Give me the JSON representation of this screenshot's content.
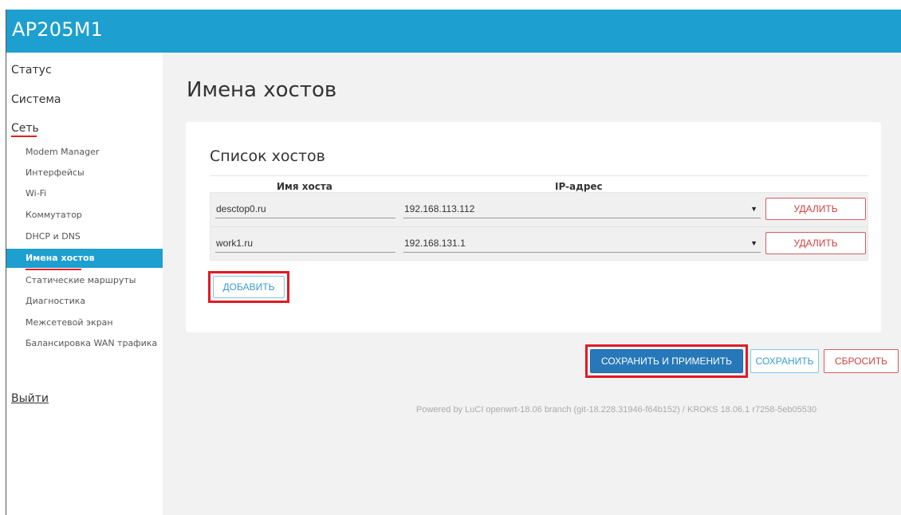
{
  "header": {
    "title": "AP205M1"
  },
  "sidebar": {
    "top_items": [
      "Статус",
      "Система",
      "Сеть"
    ],
    "sub_items": [
      "Modem Manager",
      "Интерфейсы",
      "Wi-Fi",
      "Коммутатор",
      "DHCP и DNS",
      "Имена хостов",
      "Статические маршруты",
      "Диагностика",
      "Межсетевой экран",
      "Балансировка WAN трафика"
    ],
    "active_item": "Имена хостов",
    "logout": "Выйти"
  },
  "main": {
    "page_title": "Имена хостов",
    "section_title": "Список хостов",
    "columns": [
      "Имя хоста",
      "IP-адрес"
    ],
    "rows": [
      {
        "host": "desctop0.ru",
        "ip": "192.168.113.112",
        "delete": "УДАЛИТЬ"
      },
      {
        "host": "work1.ru",
        "ip": "192.168.131.1",
        "delete": "УДАЛИТЬ"
      }
    ],
    "add_button": "ДОБАВИТЬ"
  },
  "actions": {
    "save_apply": "СОХРАНИТЬ И ПРИМЕНИТЬ",
    "save": "СОХРАНИТЬ",
    "reset": "СБРОСИТЬ"
  },
  "footer": "Powered by LuCI openwrt-18.06 branch (git-18.228.31946-f64b152) / KROKS 18.06.1 r7258-5eb05530",
  "colors": {
    "accent": "#1d9fd0",
    "primary_button": "#2778b8",
    "highlight": "#e01b24",
    "danger": "#d04040"
  }
}
